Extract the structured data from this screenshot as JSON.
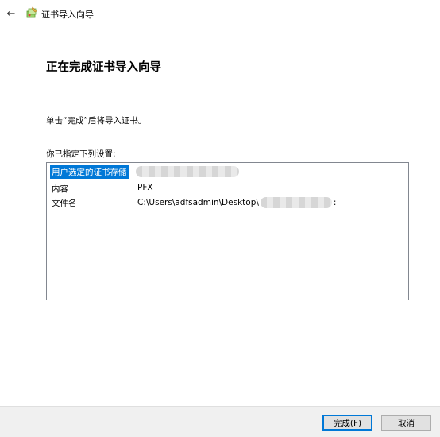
{
  "window": {
    "title": "证书导入向导",
    "back_icon": "←"
  },
  "main": {
    "heading": "正在完成证书导入向导",
    "description": "单击“完成”后将导入证书。",
    "settings_label": "你已指定下列设置:",
    "settings": [
      {
        "key": "用户选定的证书存储",
        "value": ""
      },
      {
        "key": "内容",
        "value": "PFX"
      },
      {
        "key": "文件名",
        "value": "C:\\Users\\adfsadmin\\Desktop\\",
        "suffix": ":"
      }
    ]
  },
  "footer": {
    "finish_label": "完成(F)",
    "cancel_label": "取消"
  },
  "colors": {
    "selection": "#0078d7",
    "footer_bg": "#f0f0f0",
    "border": "#828790"
  }
}
